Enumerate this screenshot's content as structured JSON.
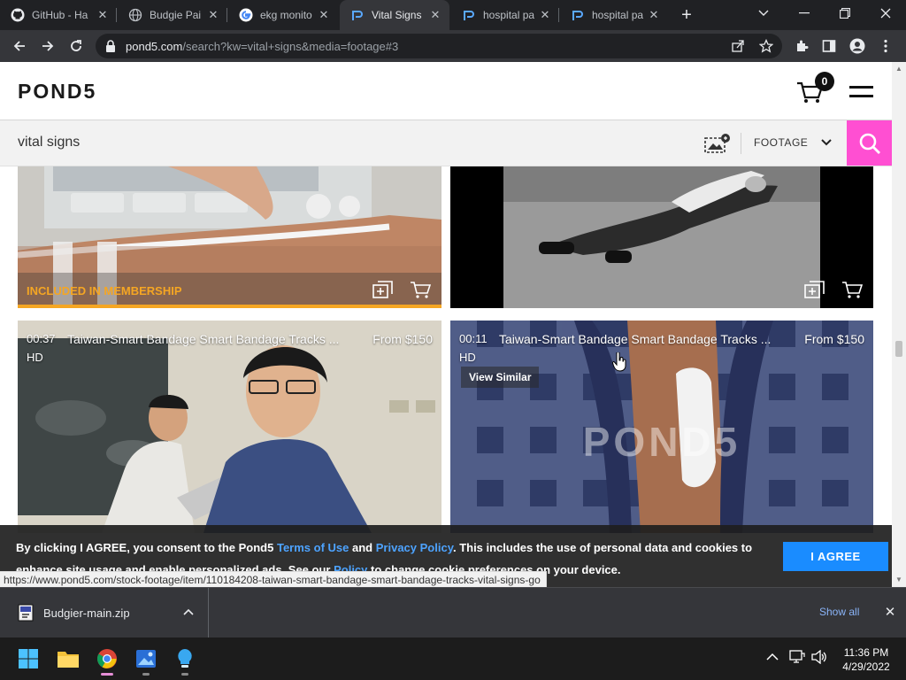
{
  "browser": {
    "tabs": [
      {
        "title": "GitHub - Ha",
        "icon": "github-icon"
      },
      {
        "title": "Budgie Pai",
        "icon": "globe-icon"
      },
      {
        "title": "ekg monito",
        "icon": "google-icon"
      },
      {
        "title": "Vital Signs",
        "icon": "pond5-icon",
        "active": true
      },
      {
        "title": "hospital pa",
        "icon": "pond5-icon"
      },
      {
        "title": "hospital pa",
        "icon": "pond5-icon"
      }
    ],
    "url_host": "pond5.com",
    "url_path": "/search?kw=vital+signs&media=footage#3"
  },
  "site": {
    "logo": "POND5",
    "cart_count": "0",
    "search_value": "vital signs",
    "media_type": "FOOTAGE"
  },
  "results": {
    "top_left": {
      "badge": "INCLUDED IN MEMBERSHIP"
    },
    "bottom_left": {
      "duration": "00:37",
      "title": "Taiwan-Smart Bandage Smart Bandage Tracks ...",
      "price": "From $150",
      "quality": "HD"
    },
    "bottom_right": {
      "duration": "00:11",
      "title": "Taiwan-Smart Bandage Smart Bandage Tracks ...",
      "price": "From $150",
      "quality": "HD",
      "view_similar": "View Similar",
      "watermark": "POND5"
    }
  },
  "cookie": {
    "text_before": "By clicking I AGREE, you consent to the Pond5",
    "terms_link": "Terms of Use",
    "and": "and",
    "privacy_link": "Privacy Policy",
    "text_after": ". This includes the use of personal data and cookies to enhance site usage and enable personalized ads. See our",
    "policy_link": "Policy",
    "text_end": "to change cookie preferences on your device.",
    "agree_label": "I AGREE"
  },
  "status_url": "https://www.pond5.com/stock-footage/item/110184208-taiwan-smart-bandage-smart-bandage-tracks-vital-signs-go",
  "downloads": {
    "file_name": "Budgier-main.zip",
    "show_all": "Show all"
  },
  "taskbar": {
    "time": "11:36 PM",
    "date": "4/29/2022"
  },
  "colors": {
    "accent_pink": "#ff4fd2",
    "membership_orange": "#f5a623",
    "agree_blue": "#1a8cff"
  }
}
